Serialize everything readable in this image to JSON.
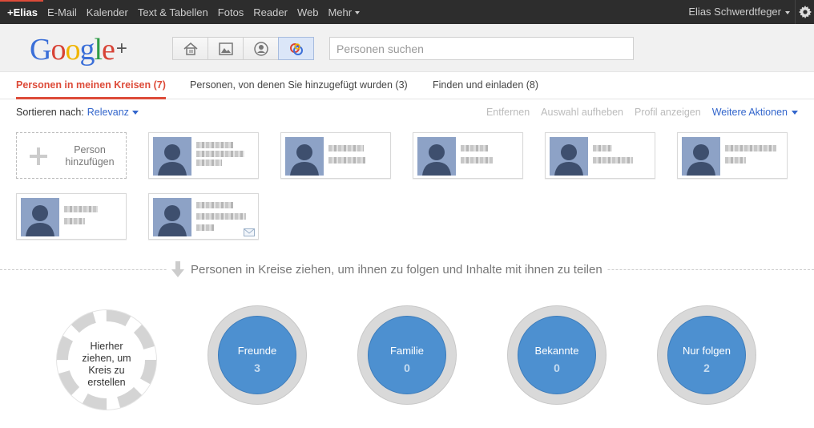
{
  "topbar": {
    "nav": [
      "+Elias",
      "E-Mail",
      "Kalender",
      "Text & Tabellen",
      "Fotos",
      "Reader",
      "Web",
      "Mehr"
    ],
    "user": "Elias Schwerdtfeger",
    "accent": "#dd4b39"
  },
  "header": {
    "logo": "Google",
    "logo_plus": "+",
    "view_icons": [
      "home-icon",
      "photos-icon",
      "profile-icon",
      "circles-icon"
    ],
    "search_placeholder": "Personen suchen"
  },
  "tabs": [
    {
      "label": "Personen in meinen Kreisen (7)",
      "active": true
    },
    {
      "label": "Personen, von denen Sie hinzugefügt wurden (3)",
      "active": false
    },
    {
      "label": "Finden und einladen (8)",
      "active": false
    }
  ],
  "sort": {
    "label": "Sortieren nach:",
    "value": "Relevanz"
  },
  "actions": {
    "remove": "Entfernen",
    "deselect": "Auswahl aufheben",
    "view_profile": "Profil anzeigen",
    "more": "Weitere Aktionen"
  },
  "add_person": {
    "label_line1": "Person",
    "label_line2": "hinzufügen"
  },
  "drag_hint": "Personen in Kreise ziehen, um ihnen zu folgen und Inhalte mit ihnen zu teilen",
  "new_circle": {
    "line1": "Hierher",
    "line2": "ziehen, um",
    "line3": "Kreis zu",
    "line4": "erstellen"
  },
  "circles": [
    {
      "name": "Freunde",
      "count": "3"
    },
    {
      "name": "Familie",
      "count": "0"
    },
    {
      "name": "Bekannte",
      "count": "0"
    },
    {
      "name": "Nur folgen",
      "count": "2"
    }
  ]
}
